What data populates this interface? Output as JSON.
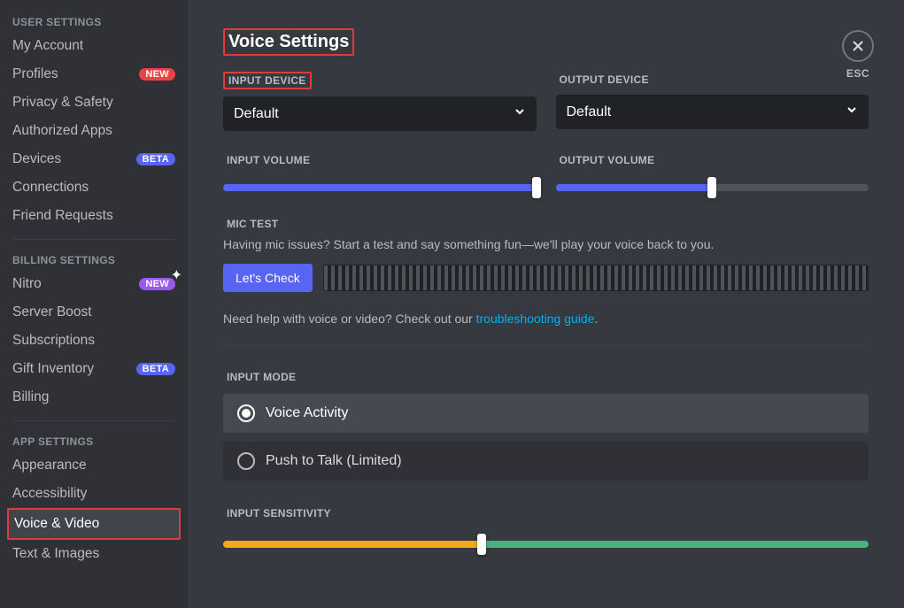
{
  "sidebar": {
    "headers": {
      "user": "USER SETTINGS",
      "billing": "BILLING SETTINGS",
      "app": "APP SETTINGS"
    },
    "user": [
      {
        "label": "My Account"
      },
      {
        "label": "Profiles",
        "badge": "NEW",
        "badgeStyle": "red"
      },
      {
        "label": "Privacy & Safety"
      },
      {
        "label": "Authorized Apps"
      },
      {
        "label": "Devices",
        "badge": "BETA",
        "badgeStyle": "beta"
      },
      {
        "label": "Connections"
      },
      {
        "label": "Friend Requests"
      }
    ],
    "billing": [
      {
        "label": "Nitro",
        "badge": "NEW",
        "badgeStyle": "purple",
        "sparkle": true
      },
      {
        "label": "Server Boost"
      },
      {
        "label": "Subscriptions"
      },
      {
        "label": "Gift Inventory",
        "badge": "BETA",
        "badgeStyle": "beta"
      },
      {
        "label": "Billing"
      }
    ],
    "app": [
      {
        "label": "Appearance"
      },
      {
        "label": "Accessibility"
      },
      {
        "label": "Voice & Video",
        "active": true,
        "highlight": true
      },
      {
        "label": "Text & Images"
      }
    ]
  },
  "page": {
    "title": "Voice Settings",
    "inputDeviceLabel": "INPUT DEVICE",
    "outputDeviceLabel": "OUTPUT DEVICE",
    "inputDeviceValue": "Default",
    "outputDeviceValue": "Default",
    "inputVolumeLabel": "INPUT VOLUME",
    "outputVolumeLabel": "OUTPUT VOLUME",
    "inputVolume": 100,
    "outputVolume": 50,
    "micTestLabel": "MIC TEST",
    "micTestDesc": "Having mic issues? Start a test and say something fun—we'll play your voice back to you.",
    "letsCheck": "Let's Check",
    "helpPrefix": "Need help with voice or video? Check out our ",
    "helpLink": "troubleshooting guide",
    "helpSuffix": ".",
    "inputModeLabel": "INPUT MODE",
    "inputModes": [
      {
        "label": "Voice Activity",
        "selected": true
      },
      {
        "label": "Push to Talk (Limited)",
        "selected": false
      }
    ],
    "inputSensitivityLabel": "INPUT SENSITIVITY",
    "sensitivityPos": 40,
    "esc": "ESC"
  }
}
